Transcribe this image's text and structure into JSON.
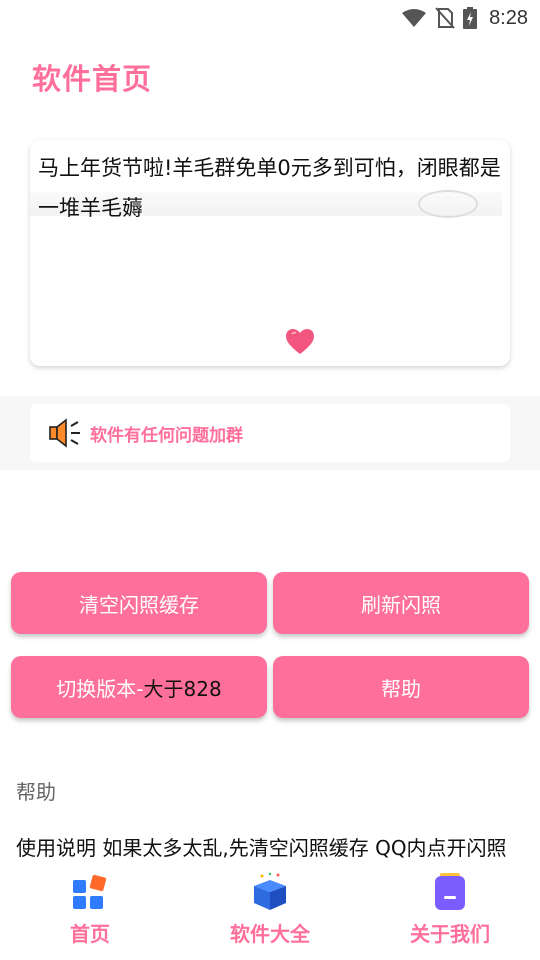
{
  "status_bar": {
    "time": "8:28"
  },
  "header": {
    "title": "软件首页"
  },
  "banner": {
    "text": "马上年货节啦!羊毛群免单0元多到可怕，闭眼都是一堆羊毛薅"
  },
  "notice": {
    "text": "软件有任何问题加群"
  },
  "buttons": {
    "clear_cache": "清空闪照缓存",
    "refresh": "刷新闪照",
    "switch_version_prefix": "切换版本-",
    "switch_version_value": "大于828",
    "help": "帮助"
  },
  "help_section": {
    "title": "帮助",
    "body": "使用说明 如果太多太乱,先清空闪照缓存 QQ内点开闪照"
  },
  "bottom_nav": {
    "items": [
      {
        "label": "首页",
        "icon": "home-grid-icon"
      },
      {
        "label": "软件大全",
        "icon": "gift-box-icon"
      },
      {
        "label": "关于我们",
        "icon": "notebook-icon"
      }
    ]
  },
  "colors": {
    "accent": "#ff6f9c",
    "heart": "#f2567f",
    "nav_home_blue": "#2f7bff",
    "nav_home_orange": "#ff6a2a",
    "nav_about_purple": "#7b5cff"
  }
}
